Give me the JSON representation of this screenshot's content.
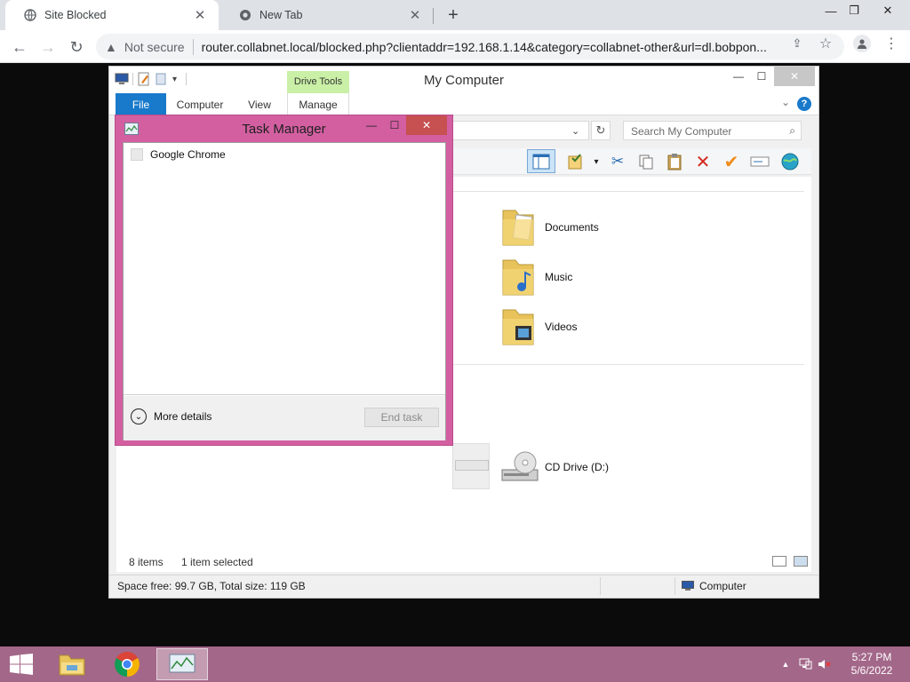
{
  "browser": {
    "tabs": [
      {
        "title": "Site Blocked",
        "active": true
      },
      {
        "title": "New Tab",
        "active": false
      }
    ],
    "address": {
      "security_label": "Not secure",
      "url": "router.collabnet.local/blocked.php?clientaddr=192.168.1.14&category=collabnet-other&url=dl.bobpon..."
    }
  },
  "explorer": {
    "title": "My Computer",
    "contextual_tab_group": "Drive Tools",
    "ribbon_tabs": [
      "File",
      "Computer",
      "View",
      "Manage"
    ],
    "search_placeholder": "Search My Computer",
    "items": [
      {
        "label": "Documents",
        "icon": "documents-folder-icon"
      },
      {
        "label": "Music",
        "icon": "music-folder-icon"
      },
      {
        "label": "Videos",
        "icon": "videos-folder-icon"
      },
      {
        "label": "CD Drive (D:)",
        "icon": "cd-drive-icon"
      }
    ],
    "status": {
      "item_count": "8 items",
      "selection": "1 item selected",
      "space": "Space free: 99.7 GB, Total size: 119 GB",
      "location": "Computer"
    }
  },
  "task_manager": {
    "title": "Task Manager",
    "processes": [
      "Google Chrome"
    ],
    "more_details_label": "More details",
    "end_task_label": "End task"
  },
  "taskbar": {
    "apps": [
      "file-explorer-icon",
      "chrome-icon",
      "task-manager-icon"
    ],
    "clock": {
      "time": "5:27 PM",
      "date": "5/6/2022"
    }
  },
  "colors": {
    "accent": "#1979ca",
    "taskbar": "#a36789",
    "task_manager_frame": "#d35fa1",
    "drive_tools": "#c9f0a6"
  }
}
